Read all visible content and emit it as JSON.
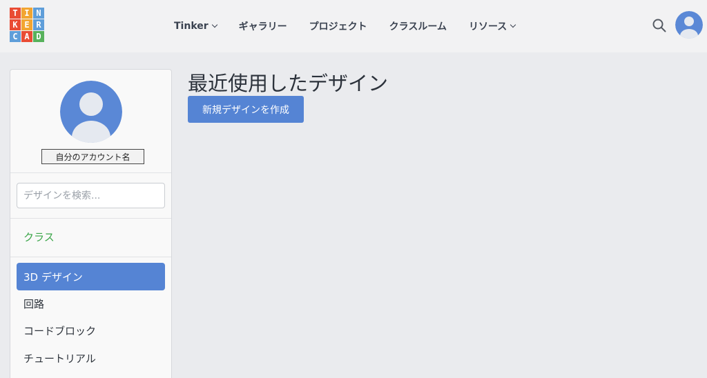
{
  "logo": {
    "letters": [
      "T",
      "I",
      "N",
      "K",
      "E",
      "R",
      "C",
      "A",
      "D"
    ],
    "colors": [
      "#e94c34",
      "#f2a531",
      "#5f9ed9",
      "#e94c34",
      "#f2a531",
      "#5f9ed9",
      "#5f9ed9",
      "#e94c34",
      "#58b25c"
    ]
  },
  "nav": {
    "items": [
      {
        "label": "Tinker",
        "has_dropdown": true
      },
      {
        "label": "ギャラリー",
        "has_dropdown": false
      },
      {
        "label": "プロジェクト",
        "has_dropdown": false
      },
      {
        "label": "クラスルーム",
        "has_dropdown": false
      },
      {
        "label": "リソース",
        "has_dropdown": true
      }
    ],
    "search_icon": "search-icon",
    "avatar_icon": "user-avatar-icon"
  },
  "sidebar": {
    "account_name": "自分のアカウント名",
    "search_placeholder": "デザインを検索...",
    "class_link": "クラス",
    "menu": [
      {
        "label": "3D デザイン",
        "active": true
      },
      {
        "label": "回路",
        "active": false
      },
      {
        "label": "コードブロック",
        "active": false
      },
      {
        "label": "チュートリアル",
        "active": false
      }
    ]
  },
  "main": {
    "title": "最近使用したデザイン",
    "create_button": "新規デザインを作成"
  },
  "colors": {
    "accent": "#5584d4",
    "class_link": "#3aa548",
    "avatar_bg": "#5a88d6",
    "avatar_figure": "#e5e9f0"
  }
}
